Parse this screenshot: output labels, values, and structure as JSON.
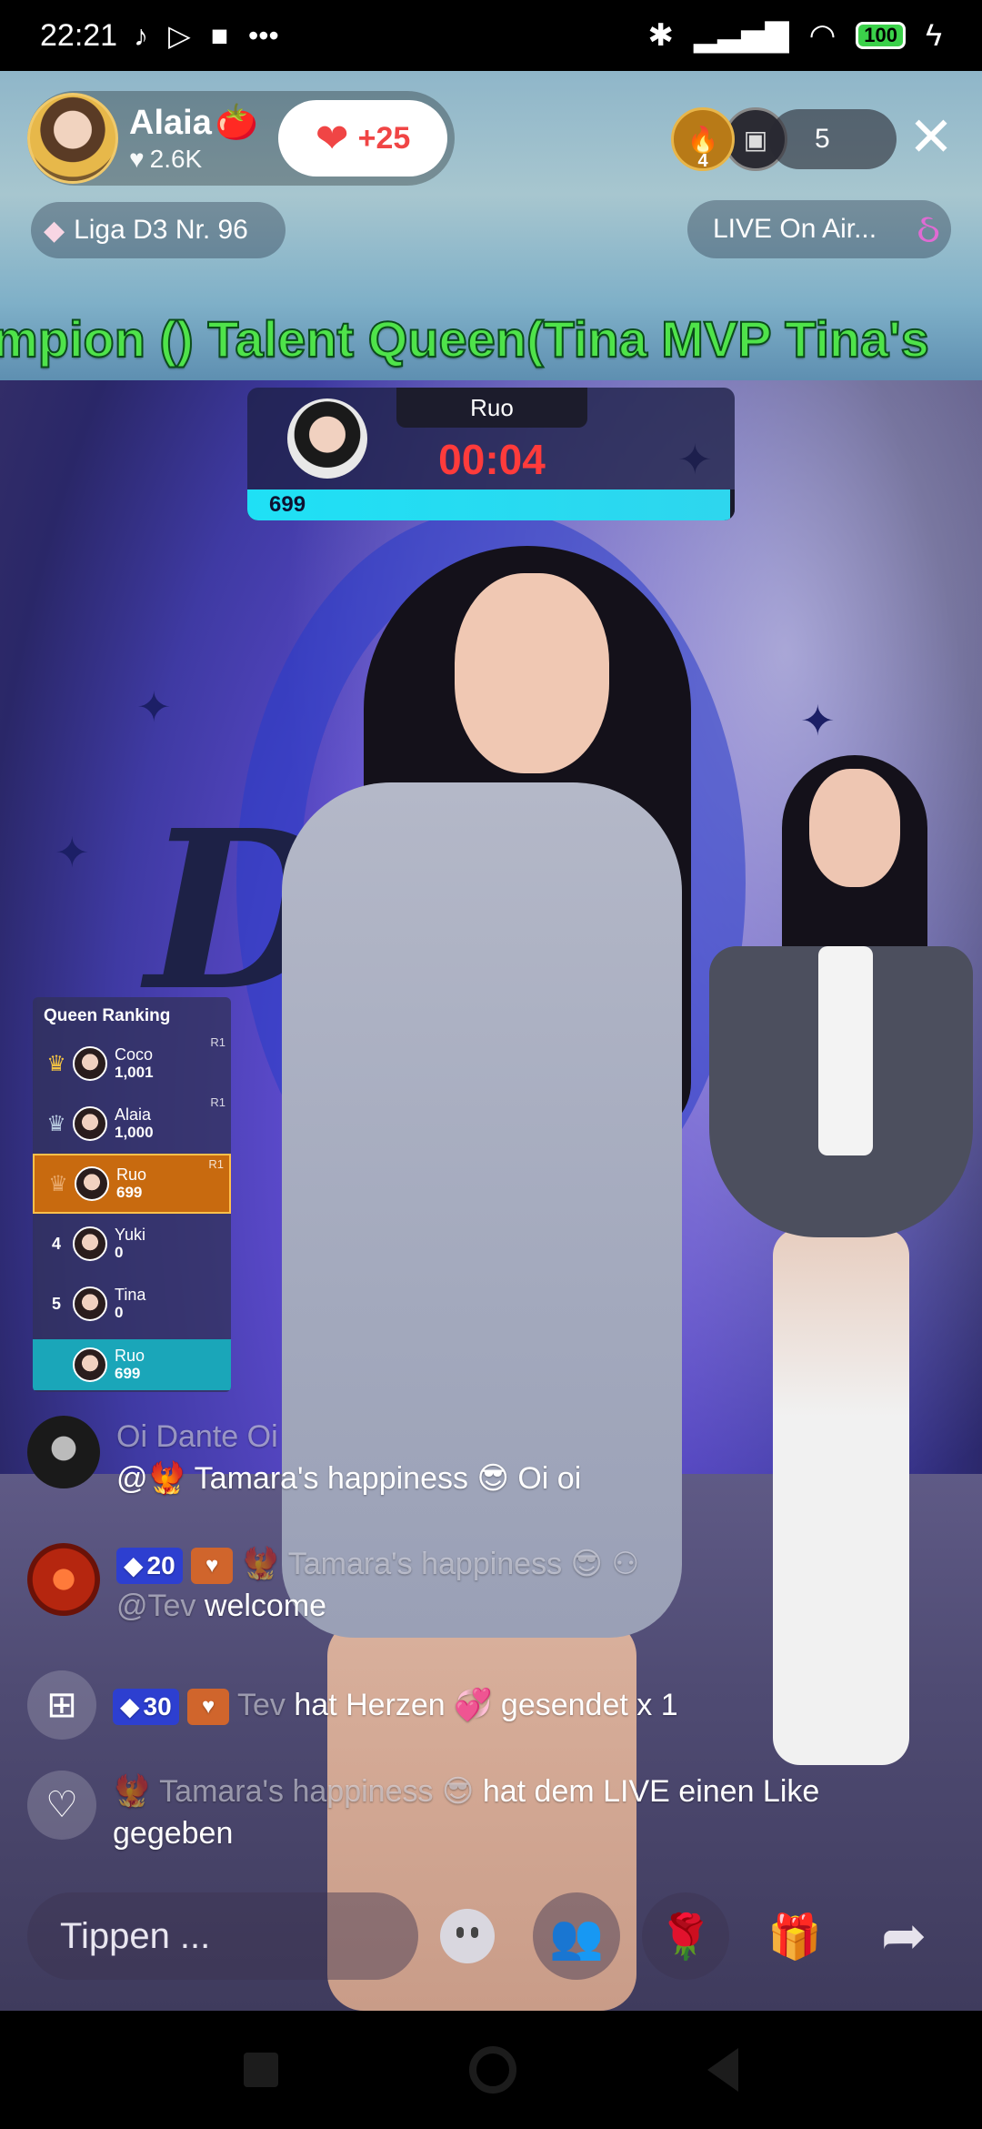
{
  "status_bar": {
    "time": "22:21",
    "notification_icons": [
      "tiktok-icon",
      "play-icon",
      "video-icon",
      "more-dots-icon"
    ],
    "battery": "100"
  },
  "host": {
    "name": "Alaia",
    "name_emoji": "🍅",
    "likes": "2.6K",
    "like_bonus": "+25"
  },
  "viewers": {
    "top_badge": "4",
    "count": "5"
  },
  "league": {
    "label": "Liga D3 Nr. 96"
  },
  "live_status": {
    "label": "LIVE On Air..."
  },
  "marquee": {
    "text": "mpion ()   Talent Queen(Tina MVP Tina's"
  },
  "timer": {
    "name": "Ruo",
    "countdown": "00:04",
    "score": "699",
    "progress": 0.99
  },
  "ranking": {
    "title": "Queen Ranking",
    "rows": [
      {
        "pos": "♛",
        "name": "Coco",
        "score": "1,001",
        "tag": "R1"
      },
      {
        "pos": "♛",
        "name": "Alaia",
        "score": "1,000",
        "tag": "R1"
      },
      {
        "pos": "♛",
        "name": "Ruo",
        "score": "699",
        "tag": "R1"
      },
      {
        "pos": "4",
        "name": "Yuki",
        "score": "0",
        "tag": ""
      },
      {
        "pos": "5",
        "name": "Tina",
        "score": "0",
        "tag": ""
      }
    ],
    "self": {
      "name": "Ruo",
      "score": "699"
    }
  },
  "comments": [
    {
      "user": "Oi Dante Oi",
      "text": "@🐦‍🔥 Tamara's happiness 😎 Oi oi"
    },
    {
      "diamond_level": "20",
      "user": "🐦‍🔥 Tamara's happiness 😎",
      "mention": "@Tev",
      "text": "welcome"
    },
    {
      "diamond_level": "30",
      "user": "Tev",
      "text": "hat Herzen 💞 gesendet x 1"
    },
    {
      "user": "🐦‍🔥 Tamara's happiness 😎",
      "text": "hat dem LIVE einen Like",
      "text2": "gegeben"
    }
  ],
  "bottom_bar": {
    "input_placeholder": "Tippen ..."
  },
  "colors": {
    "accent": "#ff2d55",
    "timer_red": "#ff3b3b",
    "marquee_green": "#4fe34a",
    "progress_cyan": "#1fe0f5",
    "rank_highlight": "#c86a0f"
  }
}
